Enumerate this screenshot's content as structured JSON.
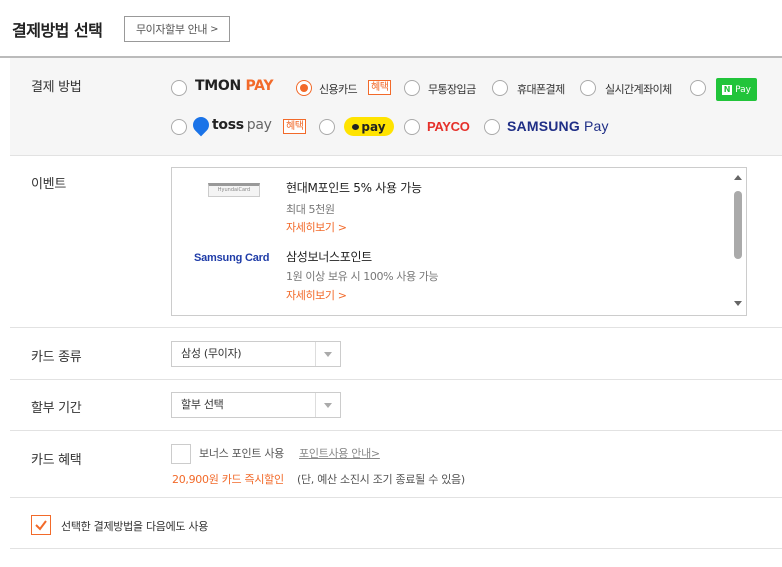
{
  "header": {
    "title": "결제방법 선택",
    "info_button": "무이자할부 안내",
    "info_chevron": ">"
  },
  "payment": {
    "label": "결제 방법",
    "tmon_pay": {
      "left": "TMON",
      "right": "PAY"
    },
    "credit_card": "신용카드",
    "credit_badge": "혜택",
    "bank_deposit": "무통장입금",
    "mobile": "휴대폰결제",
    "realtime_transfer": "실시간계좌이체",
    "npay": {
      "n": "N",
      "text": "Pay"
    },
    "toss": {
      "bold": "toss",
      "light": "pay"
    },
    "toss_badge": "혜택",
    "kakao": "pay",
    "payco": "PAYCO",
    "samsung": {
      "brand": "SAMSUNG",
      "pay": "Pay"
    },
    "selected": "credit_card"
  },
  "event": {
    "label": "이벤트",
    "items": [
      {
        "card_logo": "HyundaiCard",
        "title": "현대M포인트 5% 사용 가능",
        "sub": "최대 5천원",
        "link": "자세히보기 >"
      },
      {
        "card_logo": "Samsung Card",
        "title": "삼성보너스포인트",
        "sub": "1원 이상 보유 시 100% 사용 가능",
        "link": "자세히보기 >"
      }
    ]
  },
  "card_type": {
    "label": "카드 종류",
    "value": "삼성 (무이자)"
  },
  "installment": {
    "label": "할부 기간",
    "value": "할부 선택"
  },
  "card_benefit": {
    "label": "카드 혜택",
    "checkbox_text": "보너스 포인트 사용",
    "link": "포인트사용 안내>",
    "discount": "20,900원 카드 즉시할인",
    "discount_note": "(단, 예산 소진시 조기 종료될 수 있음)",
    "checked": false
  },
  "save_method": {
    "label": "선택한 결제방법을 다음에도 사용",
    "checked": true
  },
  "colors": {
    "accent": "#f26a2a",
    "npay_green": "#21c43a",
    "kakao_yellow": "#ffe300",
    "payco_red": "#e5302a",
    "samsung_blue": "#1f2e86",
    "toss_blue": "#1a73e8"
  }
}
